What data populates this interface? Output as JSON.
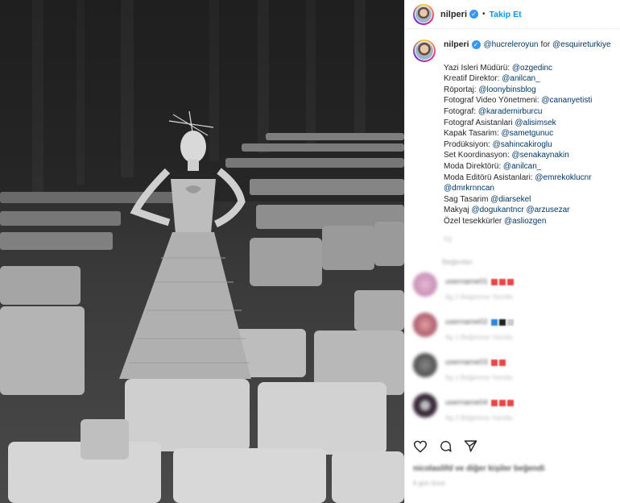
{
  "header": {
    "username": "nilperi",
    "separator": "•",
    "follow_label": "Takip Et"
  },
  "caption": {
    "username": "nilperi",
    "for_word": "for",
    "mention_primary": "@hucreleroyun",
    "mention_secondary": "@esquireturkiye",
    "credits": [
      {
        "role": "Yazi Isleri Müdürü:",
        "handle": "@ozgedinc"
      },
      {
        "role": "Kreatif Direktor:",
        "handle": "@anilcan_"
      },
      {
        "role": "Röportaj:",
        "handle": "@loonybinsblog"
      },
      {
        "role": "Fotograf Video Yönetmeni:",
        "handle": "@cananyetisti"
      },
      {
        "role": "Fotograf:",
        "handle": "@karademirburcu"
      },
      {
        "role": "Fotograf Asistanlari",
        "handle": "@alisimsek"
      },
      {
        "role": "Kapak Tasarim:",
        "handle": "@sametgunuc"
      },
      {
        "role": "Prodüksiyon:",
        "handle": "@sahincakiroglu"
      },
      {
        "role": "Set Koordinasyon:",
        "handle": "@senakaynakin"
      },
      {
        "role": "Moda Direktörü:",
        "handle": "@anilcan_"
      },
      {
        "role": "Moda Editörü Asistanlari:",
        "handle": "@emrekoklucnr"
      },
      {
        "role": "",
        "handle": "@dmrkrnncan"
      },
      {
        "role": "Sag Tasarim",
        "handle": "@diarsekel"
      },
      {
        "role": "Makyaj",
        "handle": "@dogukantncr @arzusezar"
      },
      {
        "role": "Özel tesekkürler",
        "handle": "@asliozgen"
      }
    ],
    "time_blurred": "6g"
  },
  "comments_label_blurred": "Beğeniler",
  "comments": [
    {
      "name": "username01",
      "meta": "6g  2 Beğenme  Yanıtla",
      "avatar_color": "#d6a0c8",
      "emoji_colors": [
        "#e84545",
        "#e84545",
        "#e84545"
      ]
    },
    {
      "name": "username02",
      "meta": "6g  1 Beğenme  Yanıtla",
      "avatar_color": "#b5566f",
      "emoji_colors": [
        "#2e86de",
        "#222222",
        "#cccccc"
      ]
    },
    {
      "name": "username03",
      "meta": "6g  1 Beğenme  Yanıtla",
      "avatar_color": "#555555",
      "emoji_colors": [
        "#e84545",
        "#e84545"
      ]
    },
    {
      "name": "username04",
      "meta": "6g  2 Beğenme  Yanıtla",
      "avatar_color": "#3a2a3a",
      "emoji_colors": [
        "#e84545",
        "#e84545",
        "#e84545"
      ]
    }
  ],
  "likes_blurred": "nicolaslifd ve diğer kişiler beğendi",
  "post_date_blurred": "6 gün önce",
  "colors": {
    "accent": "#0095f6",
    "verified": "#3897f0",
    "mention": "#00376b"
  },
  "icons": [
    "heart-icon",
    "comment-icon",
    "share-icon"
  ]
}
